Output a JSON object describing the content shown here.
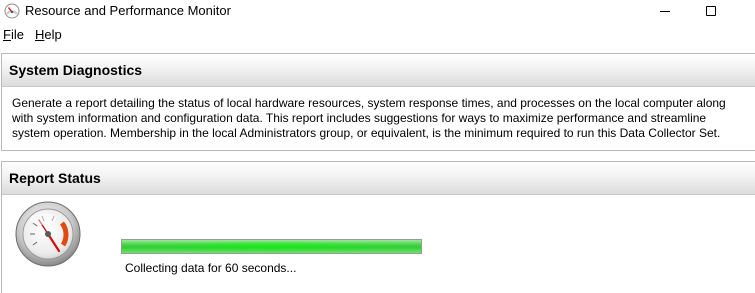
{
  "window": {
    "title": "Resource and Performance Monitor",
    "icon": "performance-monitor-icon",
    "controls": [
      "minimize-icon",
      "maximize-icon"
    ]
  },
  "menu": {
    "file": {
      "accel": "F",
      "rest": "ile"
    },
    "help": {
      "accel": "H",
      "rest": "elp"
    }
  },
  "diagnostics": {
    "header": "System Diagnostics",
    "description": "Generate a report detailing the status of local hardware resources, system response times, and processes on the local computer along with system information and configuration data. This report includes suggestions for ways to maximize performance and streamline system operation. Membership in the local Administrators group, or equivalent, is the minimum required to run this Data Collector Set."
  },
  "report_status": {
    "header": "Report Status",
    "gauge_icon": "speedometer-gauge-icon",
    "progress_fraction": 1.0,
    "status_text": "Collecting data for 60 seconds...",
    "accent_color": "#2fcf2f"
  }
}
